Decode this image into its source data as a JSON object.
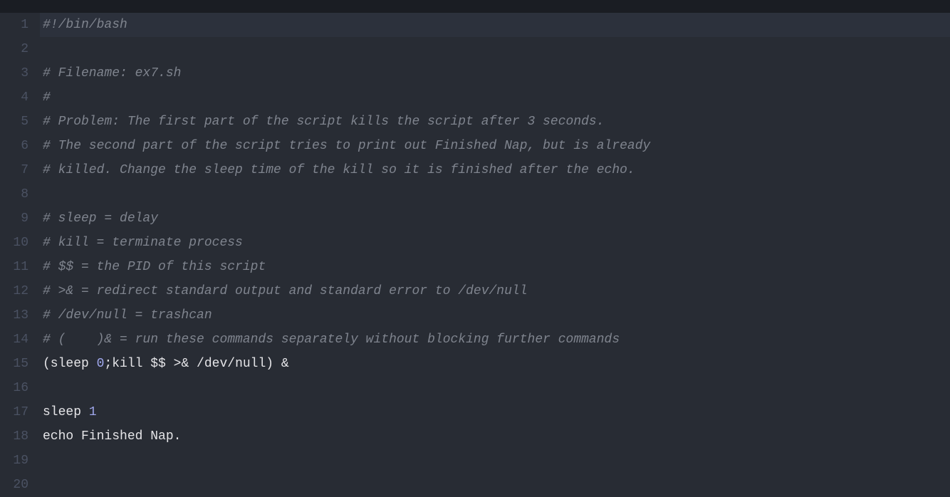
{
  "editor": {
    "lineCount": 20,
    "highlightedLine": 1,
    "lines": [
      {
        "n": 1,
        "segments": [
          {
            "cls": "comment",
            "text": "#!/bin/bash"
          }
        ]
      },
      {
        "n": 2,
        "segments": []
      },
      {
        "n": 3,
        "segments": [
          {
            "cls": "comment",
            "text": "# Filename: ex7.sh"
          }
        ]
      },
      {
        "n": 4,
        "segments": [
          {
            "cls": "comment",
            "text": "#"
          }
        ]
      },
      {
        "n": 5,
        "segments": [
          {
            "cls": "comment",
            "text": "# Problem: The first part of the script kills the script after 3 seconds."
          }
        ]
      },
      {
        "n": 6,
        "segments": [
          {
            "cls": "comment",
            "text": "# The second part of the script tries to print out Finished Nap, but is already"
          }
        ]
      },
      {
        "n": 7,
        "segments": [
          {
            "cls": "comment",
            "text": "# killed. Change the sleep time of the kill so it is finished after the echo."
          }
        ]
      },
      {
        "n": 8,
        "segments": []
      },
      {
        "n": 9,
        "segments": [
          {
            "cls": "comment",
            "text": "# sleep = delay"
          }
        ]
      },
      {
        "n": 10,
        "segments": [
          {
            "cls": "comment",
            "text": "# kill = terminate process"
          }
        ]
      },
      {
        "n": 11,
        "segments": [
          {
            "cls": "comment",
            "text": "# $$ = the PID of this script"
          }
        ]
      },
      {
        "n": 12,
        "segments": [
          {
            "cls": "comment",
            "text": "# >& = redirect standard output and standard error to /dev/null"
          }
        ]
      },
      {
        "n": 13,
        "segments": [
          {
            "cls": "comment",
            "text": "# /dev/null = trashcan"
          }
        ]
      },
      {
        "n": 14,
        "segments": [
          {
            "cls": "comment",
            "text": "# (    )& = run these commands separately without blocking further commands"
          }
        ]
      },
      {
        "n": 15,
        "segments": [
          {
            "cls": "plain",
            "text": "(sleep "
          },
          {
            "cls": "number",
            "text": "0"
          },
          {
            "cls": "plain",
            "text": ";kill $$ >& /dev/null) &"
          }
        ]
      },
      {
        "n": 16,
        "segments": []
      },
      {
        "n": 17,
        "segments": [
          {
            "cls": "plain",
            "text": "sleep "
          },
          {
            "cls": "number",
            "text": "1"
          }
        ]
      },
      {
        "n": 18,
        "segments": [
          {
            "cls": "plain",
            "text": "echo Finished Nap."
          }
        ]
      },
      {
        "n": 19,
        "segments": []
      },
      {
        "n": 20,
        "segments": []
      }
    ]
  }
}
